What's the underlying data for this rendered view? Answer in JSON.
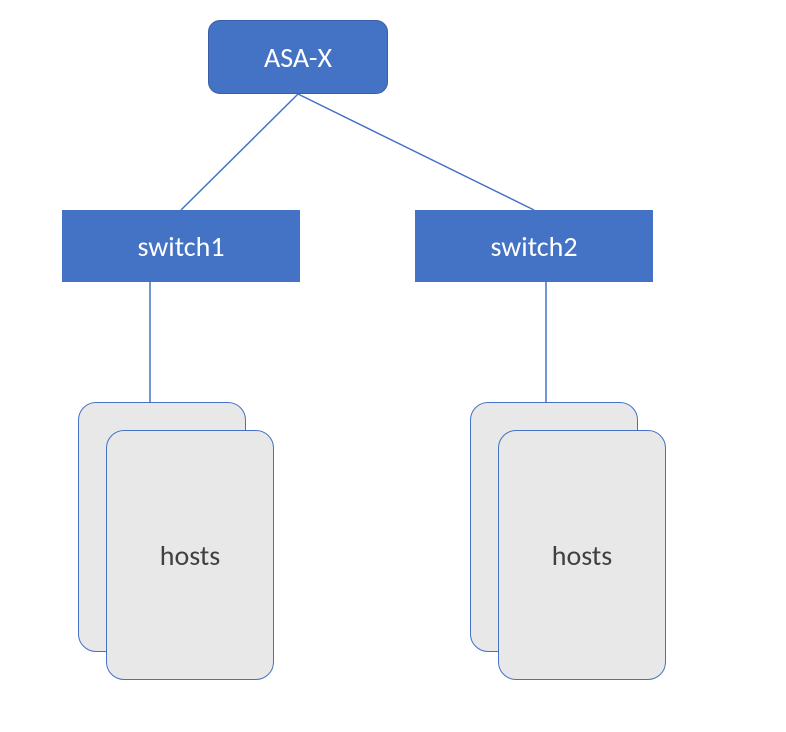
{
  "diagram": {
    "root": {
      "label": "ASA-X"
    },
    "branches": [
      {
        "switch_label": "switch1",
        "hosts_label": "hosts"
      },
      {
        "switch_label": "switch2",
        "hosts_label": "hosts"
      }
    ],
    "colors": {
      "node_fill": "#4472c4",
      "node_text": "#ffffff",
      "card_fill": "#e8e8e8",
      "card_border": "#4472c4",
      "card_text": "#404040"
    }
  }
}
